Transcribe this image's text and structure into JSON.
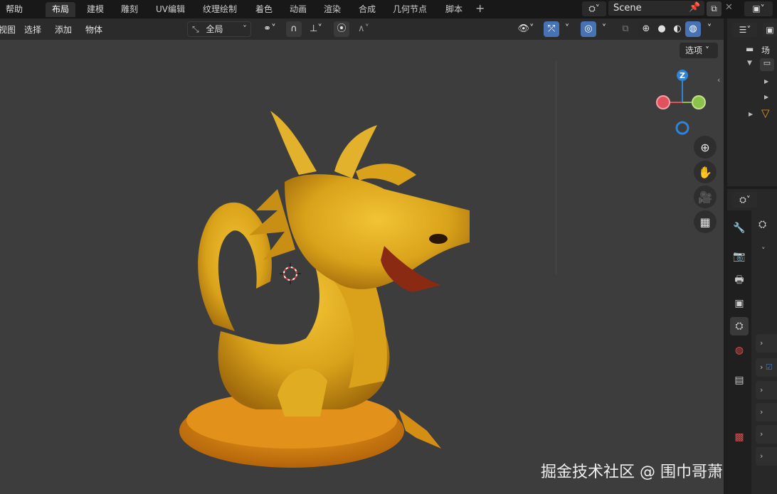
{
  "topbar": {
    "menu": [
      "帮助"
    ],
    "workspace_tabs": [
      "布局",
      "建模",
      "雕刻",
      "UV编辑",
      "纹理绘制",
      "着色",
      "动画",
      "渲染",
      "合成",
      "几何节点",
      "脚本"
    ],
    "active_tab": "布局",
    "scene_name": "Scene"
  },
  "header": {
    "menus": [
      "视图",
      "选择",
      "添加",
      "物体"
    ],
    "transform_orientation": "全局"
  },
  "viewport": {
    "options_label": "选项",
    "background_color": "#3d3d3d",
    "watermark": "掘金技术社区 @ 围巾哥萧尘"
  },
  "outliner": {
    "label": "场景"
  },
  "colors": {
    "accent": "#4772b3",
    "axis_x": "#e0525e",
    "axis_y": "#8bc34a",
    "axis_z": "#2f84d6",
    "dragon": "#d9a21a"
  }
}
